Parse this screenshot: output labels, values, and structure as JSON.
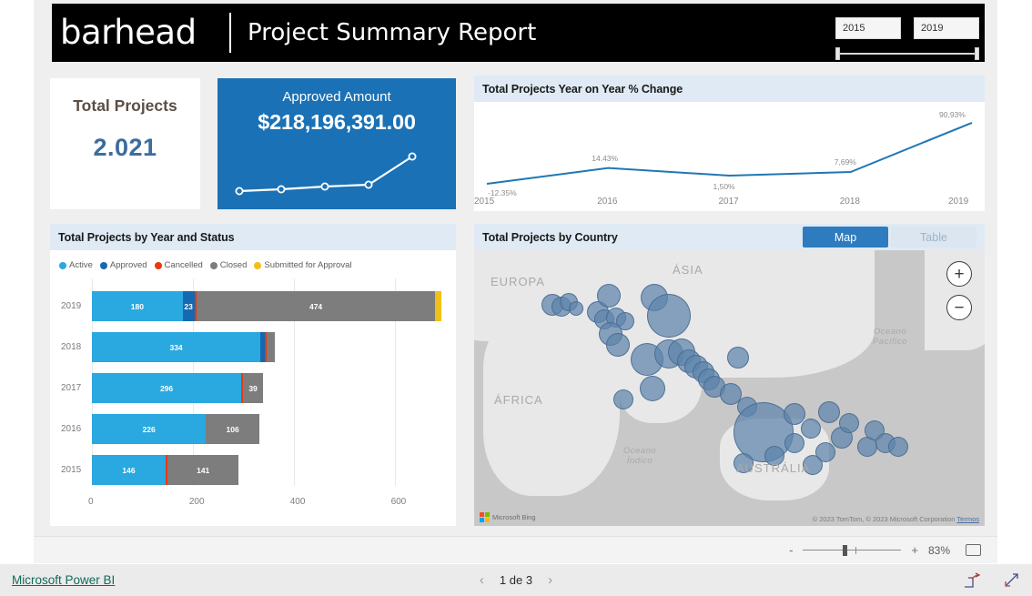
{
  "header": {
    "logo_text": "barhead",
    "title": "Project Summary Report",
    "slicer": {
      "from": "2015",
      "to": "2019"
    }
  },
  "kpi_total": {
    "label": "Total Projects",
    "value": "2.021"
  },
  "kpi_amount": {
    "label": "Approved Amount",
    "value": "$218,196,391.00"
  },
  "yoy_panel": {
    "title": "Total Projects Year on Year % Change"
  },
  "bars_panel": {
    "title": "Total Projects by Year and Status",
    "legend": [
      {
        "label": "Active",
        "color": "#2aa8e0"
      },
      {
        "label": "Approved",
        "color": "#1569b0"
      },
      {
        "label": "Cancelled",
        "color": "#e8380d"
      },
      {
        "label": "Closed",
        "color": "#7d7d7d"
      },
      {
        "label": "Submitted for Approval",
        "color": "#f0c019"
      }
    ]
  },
  "map_panel": {
    "title": "Total Projects by Country",
    "toggle": {
      "map": "Map",
      "table": "Table"
    },
    "labels": [
      {
        "text": "EUROPA"
      },
      {
        "text": "ÁSIA"
      },
      {
        "text": "ÁFRICA"
      },
      {
        "text": "AUSTRÁLIA"
      },
      {
        "text": "Oceano Índico"
      },
      {
        "text": "Oceano Pacífico"
      }
    ],
    "bing_label": "Microsoft Bing",
    "attribution": "© 2023 TomTom, © 2023 Microsoft Corporation",
    "attribution_link": "Termos",
    "zoom_in": "+",
    "zoom_out": "−"
  },
  "zoombar": {
    "minus": "-",
    "plus": "+",
    "percent": "83%"
  },
  "statusbar": {
    "brand": "Microsoft Power BI",
    "page": "1 de 3",
    "prev": "‹",
    "next": "›"
  },
  "chart_data": [
    {
      "type": "line",
      "title": "Total Projects Year on Year % Change",
      "xlabel": "",
      "ylabel": "",
      "categories": [
        "2015",
        "2016",
        "2017",
        "2018",
        "2019"
      ],
      "values": [
        -12.35,
        14.43,
        1.5,
        7.69,
        90.93
      ],
      "data_labels": [
        "-12.35%",
        "14.43%",
        "1,50%",
        "7,69%",
        "90,93%"
      ],
      "grid": false,
      "legend_position": "none",
      "line_color": "#1f77b4"
    },
    {
      "type": "bar",
      "orientation": "horizontal",
      "stacked": true,
      "title": "Total Projects by Year and Status",
      "categories": [
        "2019",
        "2018",
        "2017",
        "2016",
        "2015"
      ],
      "xlabel": "",
      "ylabel": "",
      "xlim": [
        0,
        700
      ],
      "xticks": [
        "0",
        "200",
        "400",
        "600"
      ],
      "grid": true,
      "legend_position": "top",
      "series": [
        {
          "name": "Active",
          "color": "#2aa8e0",
          "values": [
            180,
            334,
            296,
            226,
            146
          ]
        },
        {
          "name": "Approved",
          "color": "#1569b0",
          "values": [
            23,
            9,
            0,
            0,
            0
          ]
        },
        {
          "name": "Cancelled",
          "color": "#e8380d",
          "values": [
            4,
            3,
            4,
            0,
            4
          ]
        },
        {
          "name": "Closed",
          "color": "#7d7d7d",
          "values": [
            474,
            16,
            39,
            106,
            141
          ]
        },
        {
          "name": "Submitted for Approval",
          "color": "#f0c019",
          "values": [
            12,
            0,
            0,
            0,
            0
          ]
        }
      ],
      "bar_labels": [
        [
          "180",
          "23",
          "",
          "474",
          ""
        ],
        [
          "334",
          "",
          "",
          "",
          ""
        ],
        [
          "296",
          "",
          "",
          "39",
          ""
        ],
        [
          "226",
          "",
          "",
          "106",
          ""
        ],
        [
          "146",
          "",
          "",
          "141",
          ""
        ]
      ]
    },
    {
      "type": "scatter",
      "subtype": "bubble-map",
      "title": "Total Projects by Country",
      "xlabel": "",
      "ylabel": "",
      "legend_position": "none",
      "bubble_color": "#5d83ab",
      "points": [
        {
          "x": 86,
          "y": 60,
          "r": 12
        },
        {
          "x": 96,
          "y": 62,
          "r": 11
        },
        {
          "x": 104,
          "y": 57,
          "r": 10
        },
        {
          "x": 112,
          "y": 64,
          "r": 8
        },
        {
          "x": 136,
          "y": 68,
          "r": 12
        },
        {
          "x": 143,
          "y": 76,
          "r": 11
        },
        {
          "x": 148,
          "y": 50,
          "r": 13
        },
        {
          "x": 156,
          "y": 74,
          "r": 11
        },
        {
          "x": 166,
          "y": 78,
          "r": 10
        },
        {
          "x": 150,
          "y": 92,
          "r": 13
        },
        {
          "x": 158,
          "y": 104,
          "r": 13
        },
        {
          "x": 198,
          "y": 52,
          "r": 15
        },
        {
          "x": 214,
          "y": 72,
          "r": 24
        },
        {
          "x": 190,
          "y": 120,
          "r": 18
        },
        {
          "x": 214,
          "y": 114,
          "r": 16
        },
        {
          "x": 228,
          "y": 112,
          "r": 15
        },
        {
          "x": 236,
          "y": 122,
          "r": 13
        },
        {
          "x": 244,
          "y": 128,
          "r": 13
        },
        {
          "x": 252,
          "y": 134,
          "r": 12
        },
        {
          "x": 258,
          "y": 142,
          "r": 12
        },
        {
          "x": 264,
          "y": 150,
          "r": 12
        },
        {
          "x": 196,
          "y": 152,
          "r": 14
        },
        {
          "x": 164,
          "y": 164,
          "r": 11
        },
        {
          "x": 290,
          "y": 118,
          "r": 12
        },
        {
          "x": 282,
          "y": 158,
          "r": 12
        },
        {
          "x": 300,
          "y": 172,
          "r": 11
        },
        {
          "x": 318,
          "y": 200,
          "r": 33
        },
        {
          "x": 352,
          "y": 180,
          "r": 12
        },
        {
          "x": 370,
          "y": 196,
          "r": 11
        },
        {
          "x": 390,
          "y": 178,
          "r": 12
        },
        {
          "x": 404,
          "y": 206,
          "r": 12
        },
        {
          "x": 412,
          "y": 190,
          "r": 11
        },
        {
          "x": 432,
          "y": 216,
          "r": 11
        },
        {
          "x": 440,
          "y": 198,
          "r": 11
        },
        {
          "x": 452,
          "y": 212,
          "r": 11
        },
        {
          "x": 466,
          "y": 216,
          "r": 11
        },
        {
          "x": 386,
          "y": 222,
          "r": 11
        },
        {
          "x": 352,
          "y": 212,
          "r": 11
        },
        {
          "x": 372,
          "y": 236,
          "r": 11
        },
        {
          "x": 296,
          "y": 234,
          "r": 11
        },
        {
          "x": 330,
          "y": 226,
          "r": 11
        }
      ]
    }
  ]
}
